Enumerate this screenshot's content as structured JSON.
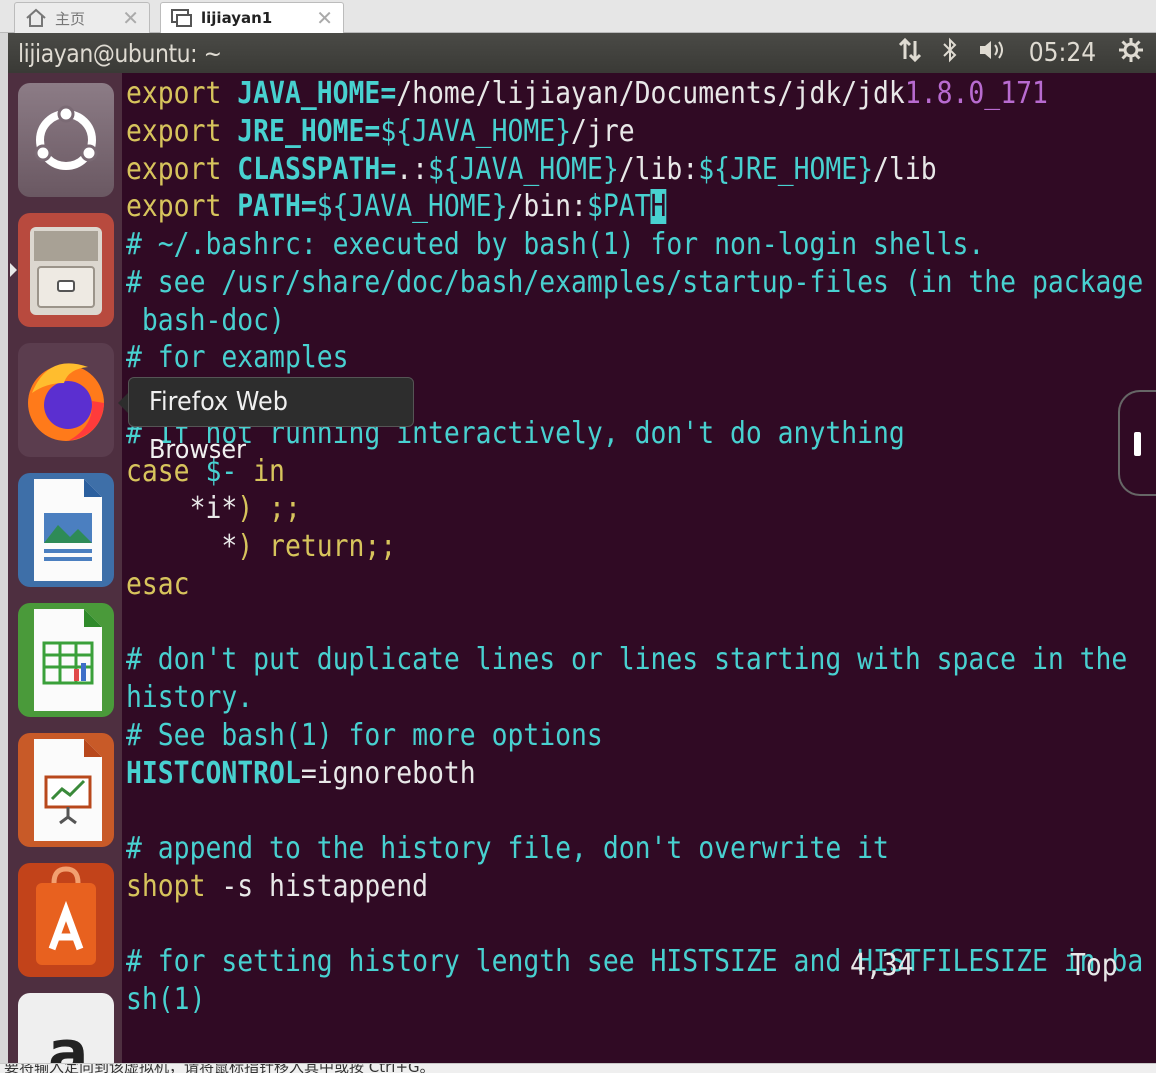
{
  "tabs": [
    {
      "label": "主页",
      "icon": "home-icon"
    },
    {
      "label": "lijiayan1",
      "icon": "vm-icon"
    }
  ],
  "panel": {
    "title": "lijiayan@ubuntu: ~",
    "time": "05:24",
    "indicators": [
      "network-icon",
      "bluetooth-icon",
      "volume-icon",
      "gear-icon"
    ]
  },
  "launcher": {
    "items": [
      "Ubuntu Dash",
      "Files",
      "Firefox Web Browser",
      "LibreOffice Writer",
      "LibreOffice Calc",
      "LibreOffice Impress",
      "Ubuntu Software",
      "Amazon"
    ]
  },
  "tooltip": {
    "label": "Firefox Web Browser"
  },
  "terminal": {
    "lines": [
      {
        "segments": [
          {
            "t": "export ",
            "c": "kw"
          },
          {
            "t": "JAVA_HOME",
            "c": "ident"
          },
          {
            "t": "=",
            "c": "ident"
          },
          {
            "t": "/home/lijiayan/Documents/jdk/jdk",
            "c": "plain"
          },
          {
            "t": "1.8.0_171",
            "c": "num"
          }
        ]
      },
      {
        "segments": [
          {
            "t": "export ",
            "c": "kw"
          },
          {
            "t": "JRE_HOME",
            "c": "ident"
          },
          {
            "t": "=",
            "c": "ident"
          },
          {
            "t": "${JAVA_HOME}",
            "c": "var"
          },
          {
            "t": "/jre",
            "c": "plain"
          }
        ]
      },
      {
        "segments": [
          {
            "t": "export ",
            "c": "kw"
          },
          {
            "t": "CLASSPATH",
            "c": "ident"
          },
          {
            "t": "=",
            "c": "ident"
          },
          {
            "t": ".:",
            "c": "plain"
          },
          {
            "t": "${JAVA_HOME}",
            "c": "var"
          },
          {
            "t": "/lib:",
            "c": "plain"
          },
          {
            "t": "${JRE_HOME}",
            "c": "var"
          },
          {
            "t": "/lib",
            "c": "plain"
          }
        ]
      },
      {
        "segments": [
          {
            "t": "export ",
            "c": "kw"
          },
          {
            "t": "PATH",
            "c": "ident"
          },
          {
            "t": "=",
            "c": "ident"
          },
          {
            "t": "${JAVA_HOME}",
            "c": "var"
          },
          {
            "t": "/bin:",
            "c": "plain"
          },
          {
            "t": "$PAT",
            "c": "var"
          },
          {
            "t": "H",
            "c": "cursor"
          }
        ]
      },
      {
        "segments": [
          {
            "t": "# ~/.bashrc: executed by bash(1) for non-login shells.",
            "c": "cmt"
          }
        ]
      },
      {
        "segments": [
          {
            "t": "# see /usr/share/doc/bash/examples/startup-files (in the package",
            "c": "cmt"
          }
        ]
      },
      {
        "segments": [
          {
            "t": " bash-doc)",
            "c": "cmt"
          }
        ]
      },
      {
        "segments": [
          {
            "t": "# for examples",
            "c": "cmt"
          }
        ]
      },
      {
        "segments": []
      },
      {
        "segments": [
          {
            "t": "# If not running interactively, don't do anything",
            "c": "cmt"
          }
        ]
      },
      {
        "segments": [
          {
            "t": "case ",
            "c": "kw"
          },
          {
            "t": "$-",
            "c": "var"
          },
          {
            "t": " in",
            "c": "kw"
          }
        ]
      },
      {
        "segments": [
          {
            "t": "    *i*",
            "c": "plain"
          },
          {
            "t": ") ;;",
            "c": "kw"
          }
        ]
      },
      {
        "segments": [
          {
            "t": "      *",
            "c": "plain"
          },
          {
            "t": ") return;;",
            "c": "kw"
          }
        ]
      },
      {
        "segments": [
          {
            "t": "esac",
            "c": "kw"
          }
        ]
      },
      {
        "segments": []
      },
      {
        "segments": [
          {
            "t": "# don't put duplicate lines or lines starting with space in the",
            "c": "cmt"
          }
        ]
      },
      {
        "segments": [
          {
            "t": "history.",
            "c": "cmt"
          }
        ]
      },
      {
        "segments": [
          {
            "t": "# See bash(1) for more options",
            "c": "cmt"
          }
        ]
      },
      {
        "segments": [
          {
            "t": "HISTCONTROL",
            "c": "ident"
          },
          {
            "t": "=ignoreboth",
            "c": "plain"
          }
        ]
      },
      {
        "segments": []
      },
      {
        "segments": [
          {
            "t": "# append to the history file, don't overwrite it",
            "c": "cmt"
          }
        ]
      },
      {
        "segments": [
          {
            "t": "shopt ",
            "c": "kw"
          },
          {
            "t": "-s histappend",
            "c": "plain"
          }
        ]
      },
      {
        "segments": []
      },
      {
        "segments": [
          {
            "t": "# for setting history length see HISTSIZE and HISTFILESIZE in ba",
            "c": "cmt"
          }
        ]
      },
      {
        "segments": [
          {
            "t": "sh(1)",
            "c": "cmt"
          }
        ]
      }
    ],
    "position": "4,34",
    "scroll": "Top"
  },
  "bottombar": {
    "hint": "要将输入定向到该虚拟机，请将鼠标指针移入其中或按 Ctrl+G。"
  },
  "colors": {
    "terminal_bg": "#300a24",
    "launcher_bg": "#4e2f40",
    "panel_bg": "#3c3b37",
    "comment": "#48d1d0",
    "keyword": "#d7c45c"
  }
}
